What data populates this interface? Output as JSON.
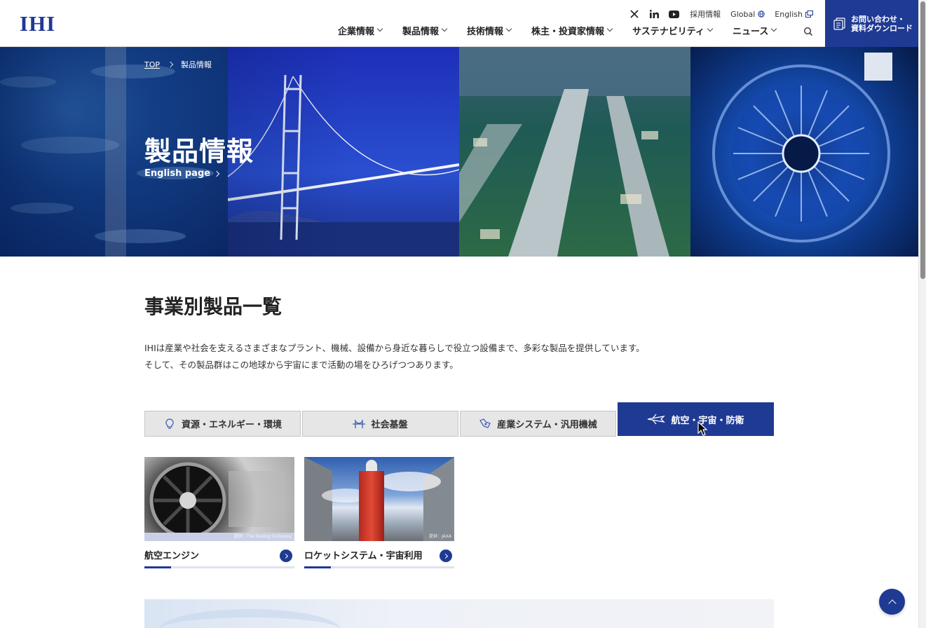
{
  "brand": {
    "logo": "IHI",
    "color": "#1f3a93"
  },
  "utility": {
    "icons": [
      "x-icon",
      "linkedin-icon",
      "youtube-icon"
    ],
    "recruit": "採用情報",
    "global": "Global",
    "english": "English"
  },
  "nav": {
    "items": [
      {
        "label": "企業情報"
      },
      {
        "label": "製品情報"
      },
      {
        "label": "技術情報"
      },
      {
        "label": "株主・投資家情報"
      },
      {
        "label": "サステナビリティ"
      },
      {
        "label": "ニュース"
      }
    ]
  },
  "contact": {
    "line1": "お問い合わせ・",
    "line2": "資料ダウンロード"
  },
  "hero": {
    "breadcrumb_top": "TOP",
    "breadcrumb_current": "製品情報",
    "title": "製品情報",
    "english_link": "English page"
  },
  "main": {
    "section_title": "事業別製品一覧",
    "intro_line1": "IHIは産業や社会を支えるさまざまなプラント、機械、設備から身近な暮らしで役立つ設備まで、多彩な製品を提供しています。",
    "intro_line2": "そして、その製品群はこの地球から宇宙にまで活動の場をひろげつつあります。",
    "tabs": [
      {
        "label": "資源・エネルギー・環境",
        "icon": "lightbulb-icon",
        "active": false
      },
      {
        "label": "社会基盤",
        "icon": "bridge-icon",
        "active": false
      },
      {
        "label": "産業システム・汎用機械",
        "icon": "machinery-icon",
        "active": false
      },
      {
        "label": "航空・宇宙・防衛",
        "icon": "airplane-icon",
        "active": true
      }
    ],
    "cards": [
      {
        "label": "航空エンジン",
        "credit": "提供：The Boeing Company"
      },
      {
        "label": "ロケットシステム・宇宙利用",
        "credit": "提供：JAXA"
      }
    ]
  }
}
